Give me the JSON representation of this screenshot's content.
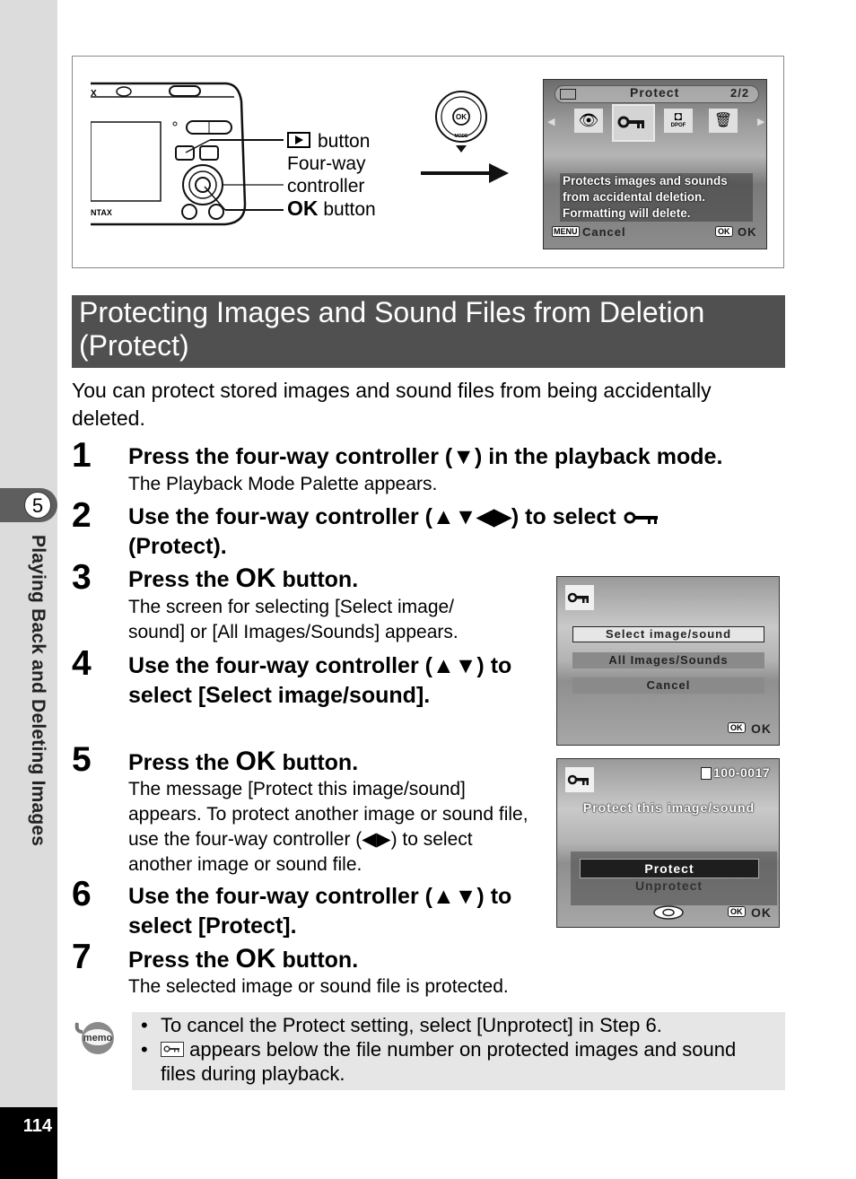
{
  "sidebar": {
    "chapter_number": "5",
    "chapter_title": "Playing Back and Deleting Images",
    "page_number": "114"
  },
  "figure": {
    "callouts": {
      "playback_button": "button",
      "four_way_line1": "Four-way",
      "four_way_line2": "controller",
      "ok_word": "OK",
      "ok_button": "button"
    },
    "controller_labels": {
      "center": "OK",
      "bottom": "MODE"
    },
    "camera_brand_fragment": "NTAX",
    "palette_screen": {
      "title": "Protect",
      "page": "2/2",
      "icons": [
        "red-eye-edit-icon",
        "protect-key-icon",
        "dpof-icon",
        "delete-icon"
      ],
      "dpof_label": "DPOF",
      "description": [
        "Protects images and sounds",
        "from accidental deletion.",
        "Formatting will delete."
      ],
      "menu_key": "MENU",
      "cancel_label": "Cancel",
      "ok_key": "OK",
      "ok_label": "OK"
    }
  },
  "section": {
    "title": "Protecting Images and Sound Files from Deletion (Protect)",
    "intro": "You can protect stored images and sound files from being accidentally deleted."
  },
  "steps": [
    {
      "num": "1",
      "head": "Press the four-way controller (▼) in the playback mode.",
      "body": "The Playback Mode Palette appears."
    },
    {
      "num": "2",
      "head_a": "Use the four-way controller (▲▼◀▶) to select",
      "head_b": "(Protect)."
    },
    {
      "num": "3",
      "head_a": "Press the",
      "ok": "OK",
      "head_b": "button.",
      "body": "The screen for selecting [Select image/ sound] or [All Images/Sounds] appears."
    },
    {
      "num": "4",
      "head": "Use the four-way controller (▲▼) to select [Select image/sound]."
    },
    {
      "num": "5",
      "head_a": "Press the",
      "ok": "OK",
      "head_b": "button.",
      "body": "The message [Protect this image/sound] appears. To protect another image or sound file, use the four-way controller (◀▶) to select another image or sound file."
    },
    {
      "num": "6",
      "head": "Use the four-way controller (▲▼) to select [Protect]."
    },
    {
      "num": "7",
      "head_a": "Press the",
      "ok": "OK",
      "head_b": "button.",
      "body": "The selected image or sound file is protected."
    }
  ],
  "screen_select": {
    "options": [
      "Select image/sound",
      "All Images/Sounds",
      "Cancel"
    ],
    "selected_index": 0,
    "ok_key": "OK",
    "ok_label": "OK"
  },
  "screen_confirm": {
    "file_number": "100-0017",
    "message": "Protect this image/sound",
    "options": [
      "Protect",
      "Unprotect"
    ],
    "selected_index": 0,
    "ok_key": "OK",
    "ok_label": "OK"
  },
  "memo": {
    "icon_label": "memo",
    "bullets": [
      "To cancel the Protect setting, select [Unprotect] in Step 6.",
      "appears below the file number on protected images and sound files during playback."
    ]
  }
}
